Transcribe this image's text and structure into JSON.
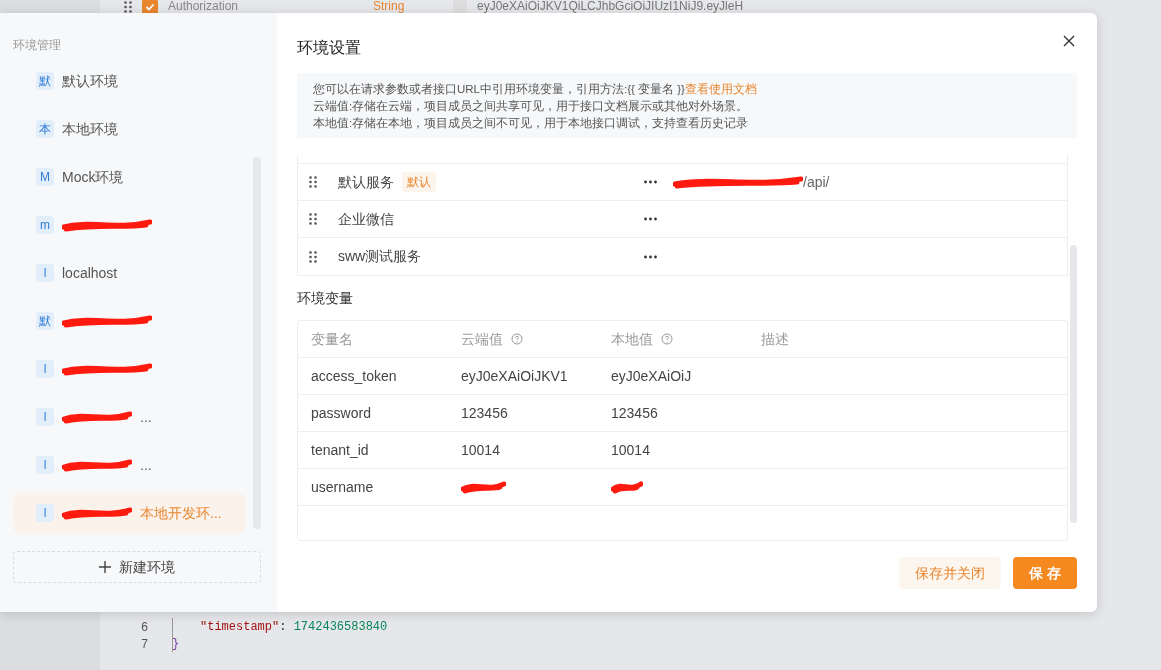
{
  "background": {
    "header_row": {
      "checked": true,
      "key": "Authorization",
      "type": "String",
      "value": "eyJ0eXAiOiJKV1QiLCJhbGciOiJIUzI1NiJ9.eyJleH"
    },
    "code_lines": [
      {
        "number": "6",
        "kind": "pair",
        "key": "\"timestamp\"",
        "colon": ":",
        "value": "1742436583840"
      },
      {
        "number": "7",
        "kind": "brace",
        "text": "}"
      }
    ]
  },
  "sidebar": {
    "title": "环境管理",
    "items": [
      {
        "badge": "默",
        "label": "默认环境",
        "redacted": false,
        "selected": false
      },
      {
        "badge": "本",
        "label": "本地环境",
        "redacted": false,
        "selected": false
      },
      {
        "badge": "M",
        "label": "Mock环境",
        "redacted": false,
        "selected": false
      },
      {
        "badge": "m",
        "redacted": true,
        "selected": false
      },
      {
        "badge": "l",
        "label": "localhost",
        "redacted": false,
        "selected": false
      },
      {
        "badge": "默",
        "redacted": true,
        "selected": false
      },
      {
        "badge": "l",
        "redacted": true,
        "selected": false
      },
      {
        "badge": "l",
        "label": "...",
        "redacted": true,
        "selected": false
      },
      {
        "badge": "l",
        "label": "...",
        "redacted": true,
        "selected": false
      },
      {
        "badge": "l",
        "label": "本地开发环...",
        "redacted": true,
        "selected": true
      }
    ],
    "new_button": "新建环境"
  },
  "dialog": {
    "title": "环境设置",
    "info": {
      "line1": "您可以在请求参数或者接口URL中引用环境变量，引用方法:{{ 变量名 }}",
      "link": "查看使用文档",
      "line2": "云端值:存储在云端，项目成员之间共享可见，用于接口文档展示或其他对外场景。",
      "line3": "本地值:存储在本地，项目成员之间不可见，用于本地接口调试，支持查看历史记录"
    },
    "services": [
      {
        "name": "默认服务",
        "tag": "默认",
        "url": "/api/",
        "url_redacted": true
      },
      {
        "name": "企业微信",
        "url_redacted": false
      },
      {
        "name": "sww测试服务",
        "url_redacted": false
      }
    ],
    "variables_title": "环境变量",
    "columns": [
      {
        "label": "变量名",
        "help": false
      },
      {
        "label": "云端值",
        "help": true
      },
      {
        "label": "本地值",
        "help": true
      },
      {
        "label": "描述",
        "help": false
      }
    ],
    "rows": [
      {
        "name": "access_token",
        "cloud": "eyJ0eXAiOiJKV1",
        "local": "eyJ0eXAiOiJ",
        "redacted": false
      },
      {
        "name": "password",
        "cloud": "123456",
        "local": "123456",
        "redacted": false
      },
      {
        "name": "tenant_id",
        "cloud": "10014",
        "local": "10014",
        "redacted": false
      },
      {
        "name": "username",
        "redacted": true
      }
    ],
    "buttons": [
      {
        "label": "保存并关闭",
        "kind": "secondary"
      },
      {
        "label": "保 存",
        "kind": "primary"
      }
    ]
  }
}
